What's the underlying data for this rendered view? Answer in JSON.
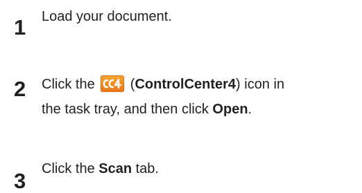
{
  "steps": [
    {
      "number": "1",
      "text": "Load your document."
    },
    {
      "number": "2",
      "part1": "Click the ",
      "icon": "controlcenter4-icon",
      "part2": " (",
      "app_name": "ControlCenter4",
      "part3": ") icon in",
      "line2_part1": "the task tray, and then click ",
      "line2_bold": "Open",
      "line2_part2": "."
    },
    {
      "number": "3",
      "part1": "Click the ",
      "bold": "Scan",
      "part2": " tab."
    }
  ],
  "colors": {
    "text": "#231f20",
    "icon_orange": "#f28a1e",
    "icon_glyph": "#ffffff"
  }
}
